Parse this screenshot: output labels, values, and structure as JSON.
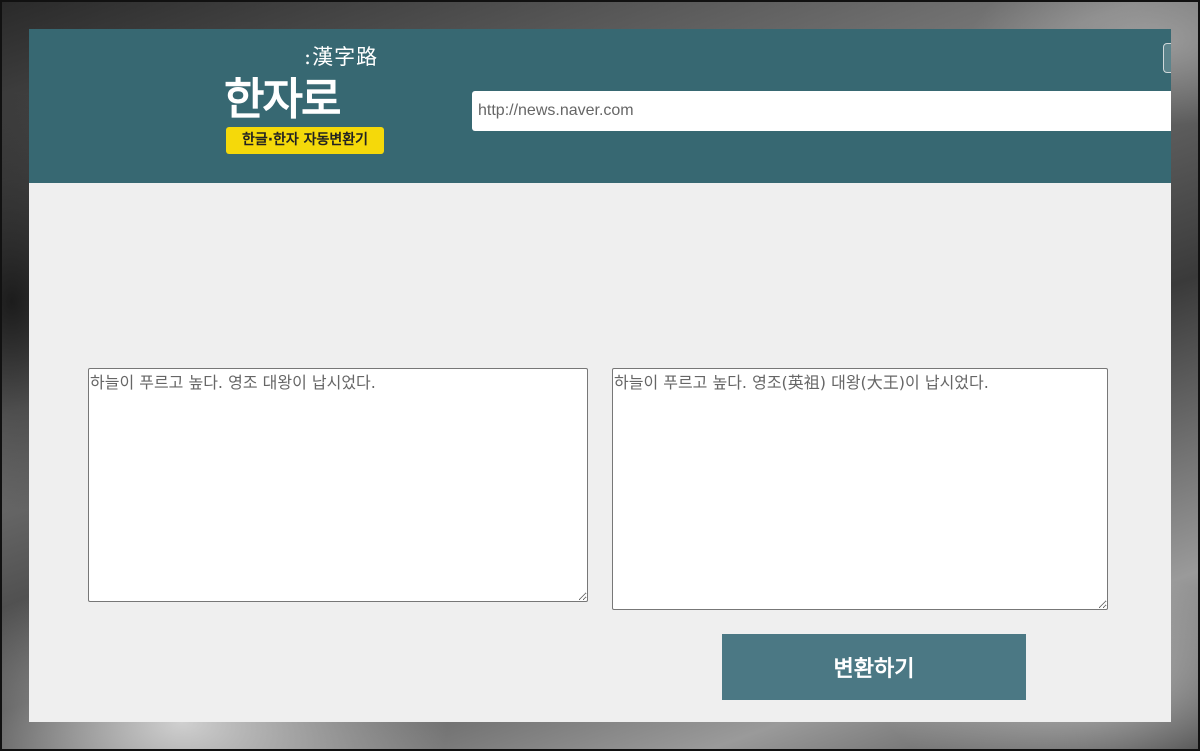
{
  "logo": {
    "hanja": ":漢字路",
    "hangul": "한자로",
    "badge": "한글·한자 자동변환기"
  },
  "header": {
    "url_placeholder": "http://news.naver.com"
  },
  "editor": {
    "input_placeholder": "하늘이 푸르고 높다. 영조 대왕이 납시었다.",
    "output_placeholder": "하늘이 푸르고 높다. 영조(英祖) 대왕(大王)이 납시었다."
  },
  "actions": {
    "convert_label": "변환하기"
  },
  "colors": {
    "header_bg": "#376872",
    "badge_bg": "#f5d90a",
    "button_bg": "#4b7884",
    "page_bg": "#efefef"
  }
}
